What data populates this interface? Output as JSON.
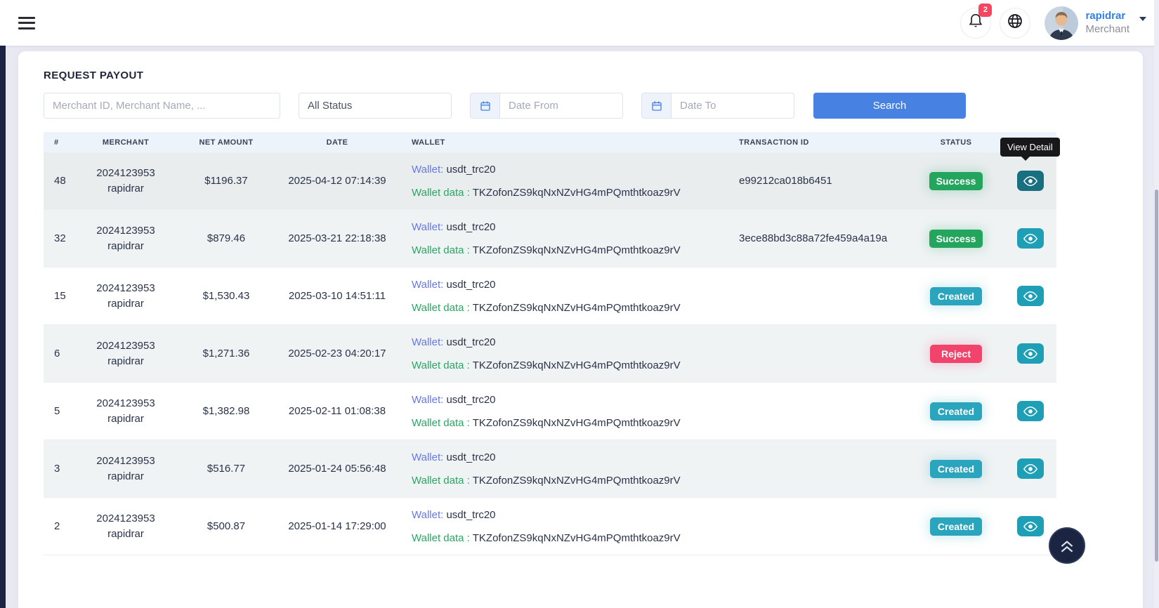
{
  "header": {
    "notification_count": "2",
    "username": "rapidrar",
    "role": "Merchant"
  },
  "page": {
    "title": "REQUEST PAYOUT"
  },
  "filters": {
    "search_placeholder": "Merchant ID, Merchant Name, ...",
    "status_value": "All Status",
    "date_from_placeholder": "Date From",
    "date_to_placeholder": "Date To",
    "search_button": "Search"
  },
  "tooltip": {
    "text": "View Detail"
  },
  "table": {
    "headers": {
      "id": "#",
      "merchant": "MERCHANT",
      "amount": "NET AMOUNT",
      "date": "DATE",
      "wallet": "WALLET",
      "txn": "TRANSACTION ID",
      "status": "STATUS"
    },
    "wallet_label": "Wallet:",
    "wallet_data_label": "Wallet data :",
    "status_colors": {
      "Success": "#23a55e",
      "Created": "#2aa5bd",
      "Reject": "#f1436b"
    },
    "rows": [
      {
        "id": "48",
        "merchant_id": "2024123953",
        "merchant_name": "rapidrar",
        "amount": "$1196.37",
        "date": "2025-04-12 07:14:39",
        "wallet": "usdt_trc20",
        "wallet_data": "TKZofonZS9kqNxNZvHG4mPQmthtkoaz9rV",
        "transaction_id": "e99212ca018b6451",
        "status": "Success",
        "hovered": true,
        "striped": false
      },
      {
        "id": "32",
        "merchant_id": "2024123953",
        "merchant_name": "rapidrar",
        "amount": "$879.46",
        "date": "2025-03-21 22:18:38",
        "wallet": "usdt_trc20",
        "wallet_data": "TKZofonZS9kqNxNZvHG4mPQmthtkoaz9rV",
        "transaction_id": "3ece88bd3c88a72fe459a4a19a",
        "status": "Success",
        "hovered": false,
        "striped": true
      },
      {
        "id": "15",
        "merchant_id": "2024123953",
        "merchant_name": "rapidrar",
        "amount": "$1,530.43",
        "date": "2025-03-10 14:51:11",
        "wallet": "usdt_trc20",
        "wallet_data": "TKZofonZS9kqNxNZvHG4mPQmthtkoaz9rV",
        "transaction_id": "",
        "status": "Created",
        "hovered": false,
        "striped": false
      },
      {
        "id": "6",
        "merchant_id": "2024123953",
        "merchant_name": "rapidrar",
        "amount": "$1,271.36",
        "date": "2025-02-23 04:20:17",
        "wallet": "usdt_trc20",
        "wallet_data": "TKZofonZS9kqNxNZvHG4mPQmthtkoaz9rV",
        "transaction_id": "",
        "status": "Reject",
        "hovered": false,
        "striped": true
      },
      {
        "id": "5",
        "merchant_id": "2024123953",
        "merchant_name": "rapidrar",
        "amount": "$1,382.98",
        "date": "2025-02-11 01:08:38",
        "wallet": "usdt_trc20",
        "wallet_data": "TKZofonZS9kqNxNZvHG4mPQmthtkoaz9rV",
        "transaction_id": "",
        "status": "Created",
        "hovered": false,
        "striped": false
      },
      {
        "id": "3",
        "merchant_id": "2024123953",
        "merchant_name": "rapidrar",
        "amount": "$516.77",
        "date": "2025-01-24 05:56:48",
        "wallet": "usdt_trc20",
        "wallet_data": "TKZofonZS9kqNxNZvHG4mPQmthtkoaz9rV",
        "transaction_id": "",
        "status": "Created",
        "hovered": false,
        "striped": true
      },
      {
        "id": "2",
        "merchant_id": "2024123953",
        "merchant_name": "rapidrar",
        "amount": "$500.87",
        "date": "2025-01-14 17:29:00",
        "wallet": "usdt_trc20",
        "wallet_data": "TKZofonZS9kqNxNZvHG4mPQmthtkoaz9rV",
        "transaction_id": "",
        "status": "Created",
        "hovered": false,
        "striped": false
      }
    ]
  },
  "colors": {
    "accent_blue": "#4781e2",
    "wallet_label_blue": "#6678e8",
    "wallet_data_green": "#28a763",
    "eye_teal": "#1f9fb6",
    "eye_teal_hover": "#186f80",
    "sidebar_navy": "#1b2444",
    "notif_red": "#f8455f"
  }
}
